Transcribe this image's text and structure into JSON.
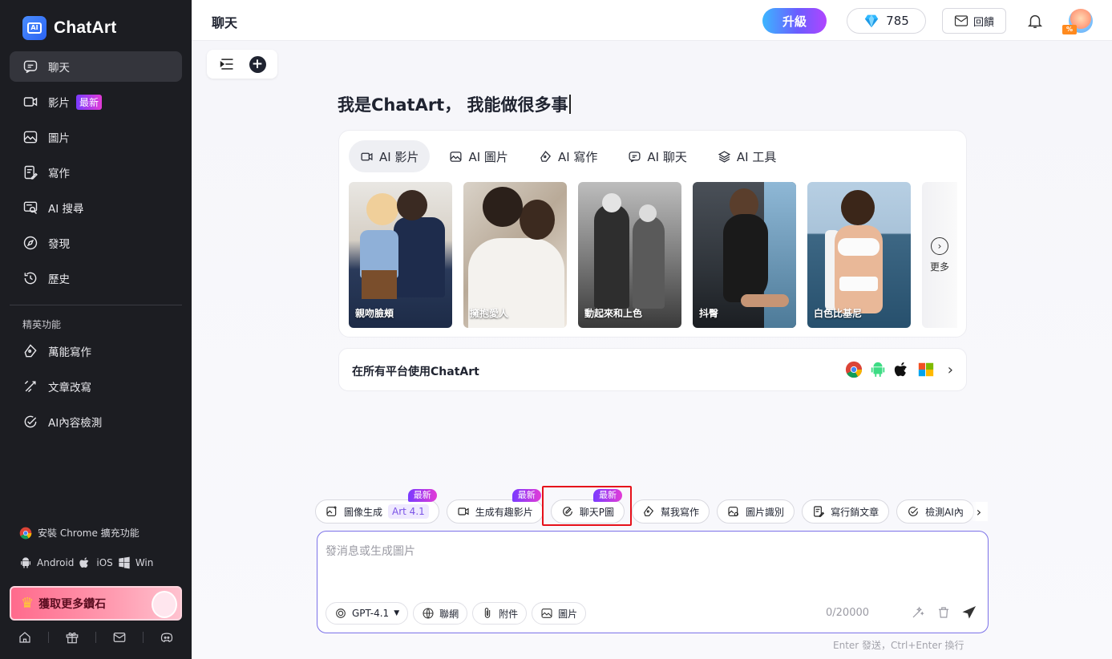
{
  "brand": {
    "name": "ChatArt",
    "logo_text": "AI"
  },
  "sidebar": {
    "items": [
      {
        "label": "聊天",
        "icon": "chat-icon",
        "active": true
      },
      {
        "label": "影片",
        "icon": "video-icon",
        "badge": "最新"
      },
      {
        "label": "圖片",
        "icon": "image-icon"
      },
      {
        "label": "寫作",
        "icon": "write-icon"
      },
      {
        "label": "AI 搜尋",
        "icon": "ai-search-icon"
      },
      {
        "label": "發現",
        "icon": "compass-icon"
      },
      {
        "label": "歷史",
        "icon": "history-icon"
      }
    ],
    "section_title": "精英功能",
    "section_items": [
      {
        "label": "萬能寫作",
        "icon": "pen-icon"
      },
      {
        "label": "文章改寫",
        "icon": "rewrite-icon"
      },
      {
        "label": "AI內容檢測",
        "icon": "check-circle-icon"
      }
    ],
    "install_label": "安裝 Chrome 擴充功能",
    "platforms": [
      "Android",
      "iOS",
      "Win"
    ],
    "promo_label": "獲取更多鑽石"
  },
  "header": {
    "title": "聊天",
    "upgrade_label": "升級",
    "diamonds": "785",
    "feedback_label": "回饋",
    "avatar_tag": "%"
  },
  "main": {
    "hero": "我是ChatArt， 我能做很多事",
    "tabs": [
      {
        "label": "AI 影片",
        "icon": "video-icon",
        "active": true
      },
      {
        "label": "AI 圖片",
        "icon": "image-icon"
      },
      {
        "label": "AI 寫作",
        "icon": "pen-icon"
      },
      {
        "label": "AI 聊天",
        "icon": "chat-icon"
      },
      {
        "label": "AI 工具",
        "icon": "layers-icon"
      }
    ],
    "thumbnails": [
      {
        "caption": "親吻臉頰"
      },
      {
        "caption": "擁抱愛人"
      },
      {
        "caption": "動起來和上色"
      },
      {
        "caption": "抖臀"
      },
      {
        "caption": "白色比基尼"
      }
    ],
    "more_label": "更多",
    "platform_banner": "在所有平台使用ChatArt"
  },
  "quick_actions": [
    {
      "label": "圖像生成",
      "tag": "Art 4.1",
      "badge": "最新",
      "icon": "image-gen-icon"
    },
    {
      "label": "生成有趣影片",
      "badge": "最新",
      "icon": "video-icon"
    },
    {
      "label": "聊天P圖",
      "badge": "最新",
      "icon": "chat-edit-icon"
    },
    {
      "label": "幫我寫作",
      "icon": "pen-icon"
    },
    {
      "label": "圖片識別",
      "icon": "image-scan-icon"
    },
    {
      "label": "寫行銷文章",
      "icon": "article-icon"
    },
    {
      "label": "檢測AI內",
      "icon": "check-circle-icon"
    }
  ],
  "input": {
    "placeholder": "發消息或生成圖片",
    "model": "GPT-4.1",
    "web_label": "聯網",
    "attach_label": "附件",
    "image_label": "圖片",
    "counter": "0/20000",
    "hint": "Enter 發送，Ctrl+Enter 換行"
  }
}
